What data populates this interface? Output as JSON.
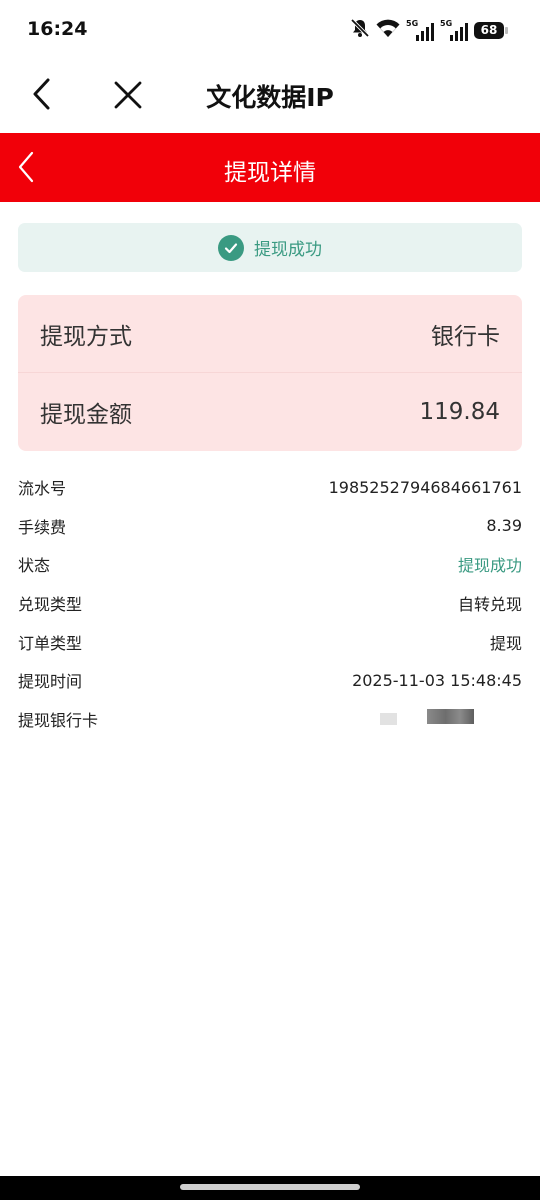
{
  "status_bar": {
    "time": "16:24",
    "network1": "5G",
    "network2": "5G",
    "battery": "68"
  },
  "nav": {
    "title": "文化数据IP"
  },
  "header": {
    "title": "提现详情",
    "color": "#f10009"
  },
  "banner": {
    "text": "提现成功",
    "color": "#3a9a82"
  },
  "summary": {
    "method_label": "提现方式",
    "method_value": "银行卡",
    "amount_label": "提现金额",
    "amount_value": "119.84"
  },
  "details": [
    {
      "label": "流水号",
      "value": "1985252794684661761"
    },
    {
      "label": "手续费",
      "value": "8.39"
    },
    {
      "label": "状态",
      "value": "提现成功"
    },
    {
      "label": "兑现类型",
      "value": "自转兑现"
    },
    {
      "label": "订单类型",
      "value": "提现"
    },
    {
      "label": "提现时间",
      "value": "2025-11-03 15:48:45"
    },
    {
      "label": "提现银行卡",
      "value": ""
    }
  ]
}
